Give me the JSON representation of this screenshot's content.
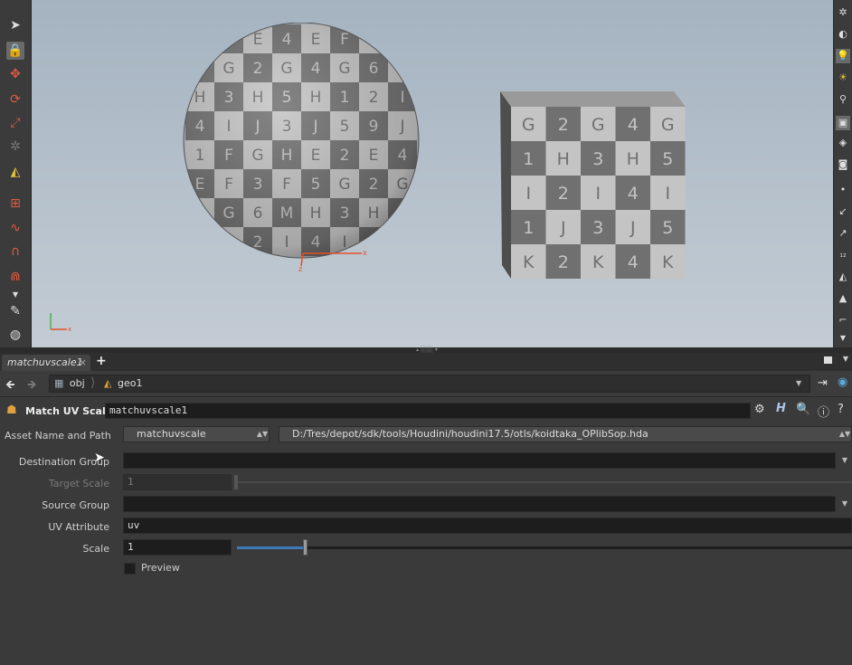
{
  "viewport": {
    "axis_x": "x",
    "axis_z": "z",
    "sphere_letters": [
      "E",
      "2",
      "E",
      "4",
      "E",
      "F",
      "3",
      "F",
      "5",
      "G",
      "2",
      "G",
      "4",
      "G",
      "6",
      "M",
      "H",
      "3",
      "H",
      "5",
      "H",
      "1",
      "2",
      "I",
      "4",
      "I",
      "J",
      "3",
      "J",
      "5",
      "9",
      "J",
      "1",
      "F",
      "G",
      "H"
    ],
    "cube_grid": [
      [
        "G",
        "2",
        "G",
        "4",
        "G"
      ],
      [
        "1",
        "H",
        "3",
        "H",
        "5"
      ],
      [
        "I",
        "2",
        "I",
        "4",
        "I"
      ],
      [
        "1",
        "J",
        "3",
        "J",
        "5"
      ],
      [
        "K",
        "2",
        "K",
        "4",
        "K"
      ]
    ]
  },
  "tabs": {
    "active_label": "matchuvscale1",
    "close_label": "×",
    "add_label": "+"
  },
  "path": {
    "crumb_obj": "obj",
    "crumb_geo": "geo1"
  },
  "node": {
    "type_label": "Match UV Scale",
    "name_value": "matchuvscale1"
  },
  "params": {
    "asset_label": "Asset Name and Path",
    "asset_name": "matchuvscale",
    "asset_path": "D:/Tres/depot/sdk/tools/Houdini/houdini17.5/otls/koidtaka_OPlibSop.hda",
    "destination_group_label": "Destination Group",
    "destination_group_value": "",
    "target_scale_label": "Target Scale",
    "target_scale_value": "1",
    "source_group_label": "Source Group",
    "source_group_value": "",
    "uv_attribute_label": "UV Attribute",
    "uv_attribute_value": "uv",
    "scale_label": "Scale",
    "scale_value": "1",
    "scale_slider_fraction": 0.11,
    "preview_label": "Preview",
    "preview_checked": false
  },
  "colors": {
    "checker_light": "#c4c4c4",
    "checker_dark": "#707070",
    "slider_accent": "#3d7ab8",
    "axis_red": "#e4502b"
  }
}
